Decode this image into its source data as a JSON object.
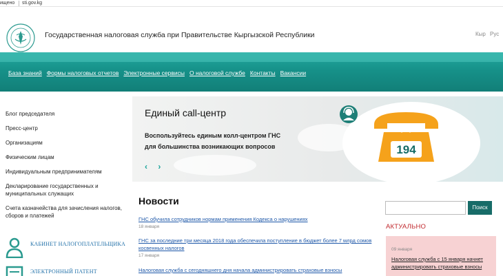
{
  "browser": {
    "security": "ищено",
    "url": "sti.gov.kg"
  },
  "header": {
    "title": "Государственная налоговая служба при Правительстве Кыргызской Республики",
    "lang_ky": "Кыр",
    "lang_ru": "Рус"
  },
  "nav": {
    "items": [
      "База знаний",
      "Формы налоговых отчетов",
      "Электронные сервисы",
      "О налоговой службе",
      "Контакты",
      "Вакансии"
    ]
  },
  "sidebar": {
    "items": [
      "Блог председателя",
      "Пресс-центр",
      "Организациям",
      "Физическим лицам",
      "Индивидуальным предпринимателям",
      "Декларирование государственных и муниципальных служащих",
      "Счета казначейства для зачисления налогов, сборов и платежей"
    ],
    "cabinet": "Кабинет налогоплательщика",
    "epatent": "Электронный патент"
  },
  "banner": {
    "title": "Единый call-центр",
    "text": "Воспользуйтесь единым колл-центром ГНС для большинства возникающих вопросов",
    "number": "194",
    "prev": "‹",
    "next": "›"
  },
  "news": {
    "heading": "Новости",
    "items": [
      {
        "title": "ГНС обучила сотрудников нормам применения Кодекса о нарушениях",
        "date": "18 января"
      },
      {
        "title": "ГНС за последние три месяца 2018 года обеспечила поступление в бюджет более 7 млрд сомов косвенных налогов",
        "date": "17 января"
      },
      {
        "title": "Налоговая служба с сегодняшнего дня начала администрировать страховые взносы",
        "date": ""
      }
    ]
  },
  "right": {
    "search_placeholder": "",
    "search_button": "Поиск",
    "actual_heading": "АКТУАЛЬНО",
    "actual_date": "09 января",
    "actual_text": "Налоговая служба с 15 января начнет администрировать страховые взносы"
  },
  "colors": {
    "teal": "#169189",
    "accent_red": "#c0282d",
    "link": "#1d57a8",
    "pink": "#f7d2d3"
  }
}
